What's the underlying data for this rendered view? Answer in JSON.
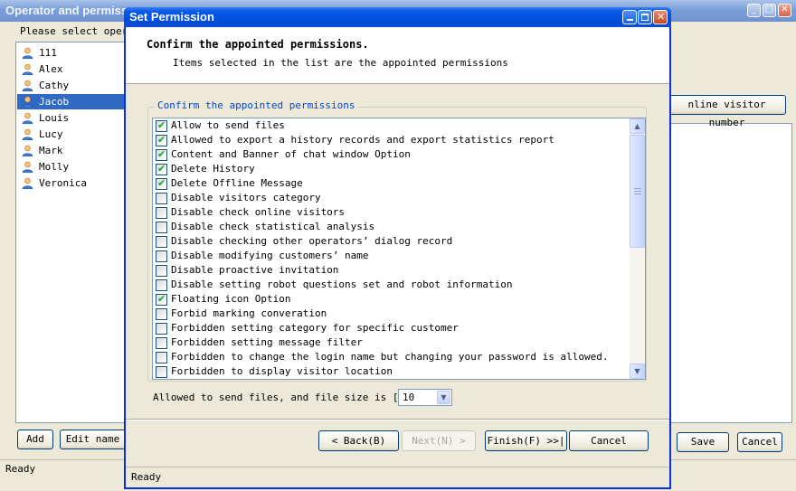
{
  "background_window": {
    "title": "Operator and permiss",
    "prompt": "Please select opera",
    "operators": [
      "111",
      "Alex",
      "Cathy",
      "Jacob",
      "Louis",
      "Lucy",
      "Mark",
      "Molly",
      "Veronica"
    ],
    "selected_operator": "Jacob",
    "add_label": "Add",
    "edit_label": "Edit name",
    "online_visitor_label": "nline visitor number",
    "save_label": "Save",
    "cancel_label": "Cancel",
    "status": "Ready"
  },
  "dialog": {
    "title": "Set Permission",
    "header_title": "Confirm the appointed permissions.",
    "header_subtitle": "Items selected in the list are the appointed permissions",
    "group_label": "Confirm the appointed permissions",
    "permissions": [
      {
        "label": "Allow to send files",
        "checked": true
      },
      {
        "label": "Allowed to export a history records and export statistics report",
        "checked": true
      },
      {
        "label": "Content and Banner of chat window Option",
        "checked": true
      },
      {
        "label": "Delete History",
        "checked": true
      },
      {
        "label": "Delete Offline Message",
        "checked": true
      },
      {
        "label": "Disable  visitors category",
        "checked": false
      },
      {
        "label": "Disable check online visitors",
        "checked": false
      },
      {
        "label": "Disable check statistical analysis",
        "checked": false
      },
      {
        "label": "Disable checking other operators’ dialog record",
        "checked": false
      },
      {
        "label": "Disable modifying customers’ name",
        "checked": false
      },
      {
        "label": "Disable proactive invitation",
        "checked": false
      },
      {
        "label": "Disable setting robot questions set and robot information",
        "checked": false
      },
      {
        "label": "Floating icon Option",
        "checked": true
      },
      {
        "label": "Forbid marking converation",
        "checked": false
      },
      {
        "label": "Forbidden setting category for specific customer",
        "checked": false
      },
      {
        "label": "Forbidden setting message filter",
        "checked": false
      },
      {
        "label": "Forbidden to change the login name but changing your password is allowed.",
        "checked": false
      },
      {
        "label": "Forbidden to display visitor location",
        "checked": false
      }
    ],
    "file_size_label": "Allowed to send files, and file size is [MB]",
    "file_size_value": "10",
    "back_label": "< Back(B)",
    "next_label": "Next(N) >",
    "finish_label": "Finish(F) >>|",
    "cancel_label": "Cancel",
    "status": "Ready"
  },
  "colors": {
    "title_bar": "#0a5ae8",
    "selection": "#316ac5",
    "group_label": "#0046d5",
    "check": "#21a121"
  },
  "icons": {
    "user": "user-icon",
    "check": "check-icon",
    "scroll_up": "arrow-up-icon",
    "scroll_down": "arrow-down-icon",
    "dropdown": "chevron-down-icon"
  }
}
